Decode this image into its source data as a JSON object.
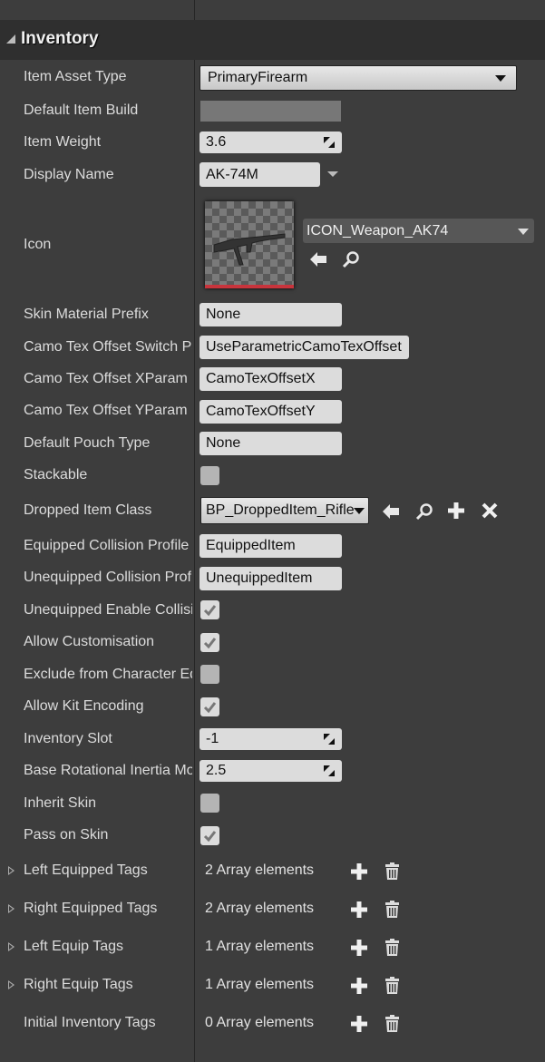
{
  "section": {
    "title": "Inventory",
    "expanded": true
  },
  "properties": {
    "item_asset_type": {
      "label": "Item Asset Type",
      "value": "PrimaryFirearm"
    },
    "default_item_build": {
      "label": "Default Item Build",
      "value": ""
    },
    "item_weight": {
      "label": "Item Weight",
      "value": "3.6"
    },
    "display_name": {
      "label": "Display Name",
      "value": "AK-74M"
    },
    "icon": {
      "label": "Icon",
      "asset": "ICON_Weapon_AK74"
    },
    "skin_material_prefix": {
      "label": "Skin Material Prefix",
      "value": "None"
    },
    "camo_switch": {
      "label": "Camo Tex Offset Switch Param",
      "value": "UseParametricCamoTexOffset"
    },
    "camo_x": {
      "label": "Camo Tex Offset XParam",
      "value": "CamoTexOffsetX"
    },
    "camo_y": {
      "label": "Camo Tex Offset YParam",
      "value": "CamoTexOffsetY"
    },
    "default_pouch": {
      "label": "Default Pouch Type",
      "value": "None"
    },
    "stackable": {
      "label": "Stackable",
      "checked": false
    },
    "dropped_item_class": {
      "label": "Dropped Item Class",
      "value": "BP_DroppedItem_Rifle"
    },
    "equipped_collision": {
      "label": "Equipped Collision Profile Name",
      "value": "EquippedItem"
    },
    "unequipped_collision": {
      "label": "Unequipped Collision Profile Name",
      "value": "UnequippedItem"
    },
    "unequipped_enable": {
      "label": "Unequipped Enable Collision",
      "checked": true
    },
    "allow_customisation": {
      "label": "Allow Customisation",
      "checked": true
    },
    "exclude_char_editor": {
      "label": "Exclude from Character Editor",
      "checked": false
    },
    "allow_kit_encoding": {
      "label": "Allow Kit Encoding",
      "checked": true
    },
    "inventory_slot": {
      "label": "Inventory Slot",
      "value": "-1"
    },
    "base_rot_inertia": {
      "label": "Base Rotational Inertia Modifier",
      "value": "2.5"
    },
    "inherit_skin": {
      "label": "Inherit Skin",
      "checked": false
    },
    "pass_on_skin": {
      "label": "Pass on Skin",
      "checked": true
    }
  },
  "arrays": [
    {
      "label": "Left Equipped Tags",
      "count_text": "2 Array elements",
      "expandable": true
    },
    {
      "label": "Right Equipped Tags",
      "count_text": "2 Array elements",
      "expandable": true
    },
    {
      "label": "Left Equip Tags",
      "count_text": "1 Array elements",
      "expandable": true
    },
    {
      "label": "Right Equip Tags",
      "count_text": "1 Array elements",
      "expandable": true
    },
    {
      "label": "Initial Inventory Tags",
      "count_text": "0 Array elements",
      "expandable": false
    }
  ],
  "colors": {
    "panel_bg": "#3d3d3d",
    "header_bg": "#2f2f2f",
    "field_bg": "#dcdcdc",
    "thumb_bar": "#c8343c"
  }
}
